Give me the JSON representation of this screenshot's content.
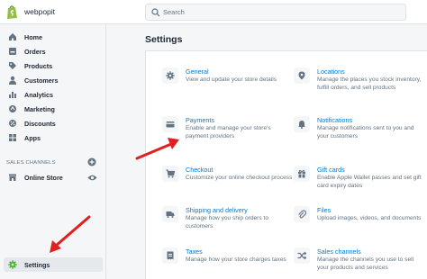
{
  "topbar": {
    "store_name": "webpopit",
    "search_placeholder": "Search"
  },
  "sidebar": {
    "items": [
      {
        "label": "Home",
        "icon": "home-icon"
      },
      {
        "label": "Orders",
        "icon": "orders-icon"
      },
      {
        "label": "Products",
        "icon": "tag-icon"
      },
      {
        "label": "Customers",
        "icon": "person-icon"
      },
      {
        "label": "Analytics",
        "icon": "bar-chart-icon"
      },
      {
        "label": "Marketing",
        "icon": "marketing-icon"
      },
      {
        "label": "Discounts",
        "icon": "discount-icon"
      },
      {
        "label": "Apps",
        "icon": "apps-icon"
      }
    ],
    "sales_channels_label": "SALES CHANNELS",
    "online_store_label": "Online Store",
    "settings_label": "Settings"
  },
  "main": {
    "title": "Settings",
    "tiles": [
      {
        "title": "General",
        "desc": "View and update your store details",
        "icon": "gear-icon"
      },
      {
        "title": "Locations",
        "desc": "Manage the places you stock inventory, fulfill orders, and sell products",
        "icon": "location-pin-icon"
      },
      {
        "title": "Payments",
        "desc": "Enable and manage your store's payment providers",
        "icon": "payment-card-icon"
      },
      {
        "title": "Notifications",
        "desc": "Manage notifications sent to you and your customers",
        "icon": "bell-icon"
      },
      {
        "title": "Checkout",
        "desc": "Customize your online checkout process",
        "icon": "cart-icon"
      },
      {
        "title": "Gift cards",
        "desc": "Enable Apple Wallet passes and set gift card expiry dates",
        "icon": "gift-icon"
      },
      {
        "title": "Shipping and delivery",
        "desc": "Manage how you ship orders to customers",
        "icon": "truck-icon"
      },
      {
        "title": "Files",
        "desc": "Upload images, videos, and documents",
        "icon": "paperclip-icon"
      },
      {
        "title": "Taxes",
        "desc": "Manage how your store charges taxes",
        "icon": "receipt-icon"
      },
      {
        "title": "Sales channels",
        "desc": "Manage the channels you use to sell your products and services",
        "icon": "shuffle-icon"
      }
    ]
  },
  "colors": {
    "link": "#007ace",
    "arrow": "#e02020",
    "sidebar_bg": "#f4f6f8",
    "brand_green": "#95bf47"
  }
}
